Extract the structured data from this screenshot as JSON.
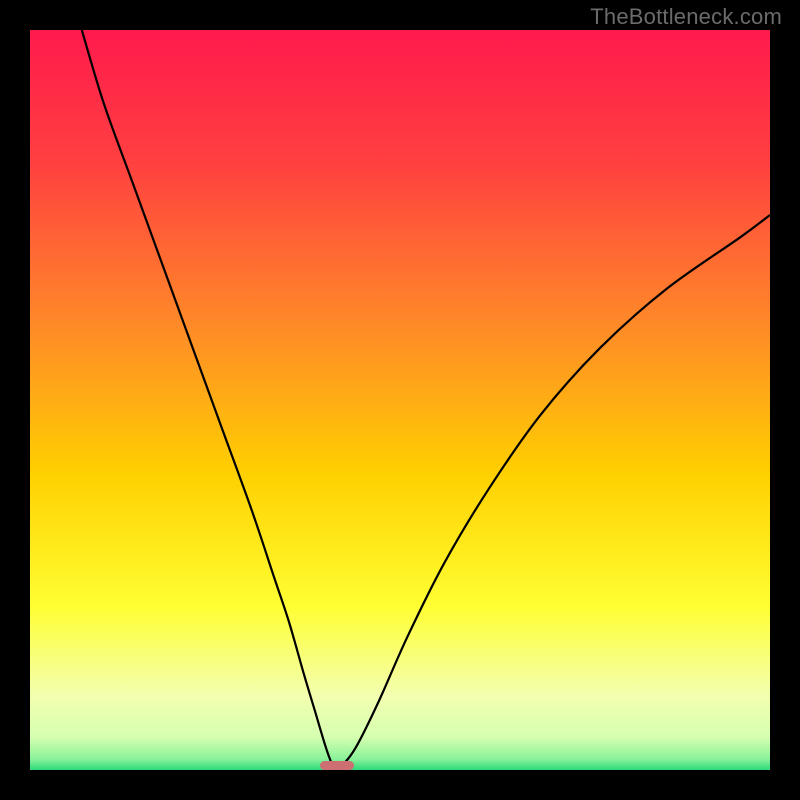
{
  "watermark": "TheBottleneck.com",
  "colors": {
    "frame_bg": "#000000",
    "gradient_stops": [
      {
        "offset": 0.0,
        "color": "#ff1a4d"
      },
      {
        "offset": 0.18,
        "color": "#ff4040"
      },
      {
        "offset": 0.4,
        "color": "#ff8a28"
      },
      {
        "offset": 0.6,
        "color": "#ffd000"
      },
      {
        "offset": 0.78,
        "color": "#ffff33"
      },
      {
        "offset": 0.9,
        "color": "#f3ffb0"
      },
      {
        "offset": 0.955,
        "color": "#d6ffb0"
      },
      {
        "offset": 0.985,
        "color": "#8bf29a"
      },
      {
        "offset": 1.0,
        "color": "#2cd97a"
      }
    ],
    "curve_stroke": "#000000",
    "marker_fill": "#cc6e72"
  },
  "chart_data": {
    "type": "line",
    "title": "",
    "xlabel": "",
    "ylabel": "",
    "xlim": [
      0,
      100
    ],
    "ylim": [
      0,
      100
    ],
    "grid": false,
    "legend": null,
    "series": [
      {
        "name": "bottleneck-curve",
        "x": [
          7,
          10,
          14,
          18,
          22,
          26,
          30,
          33,
          35,
          37,
          38.5,
          40,
          41,
          42,
          44,
          47,
          51,
          56,
          62,
          69,
          77,
          86,
          96,
          100
        ],
        "y": [
          100,
          90,
          79,
          68,
          57,
          46,
          35,
          26,
          20,
          13,
          8,
          3,
          0.5,
          0.5,
          3,
          9,
          18,
          28,
          38,
          48,
          57,
          65,
          72,
          75
        ]
      }
    ],
    "marker": {
      "x_center": 41.5,
      "y": 0,
      "width_pct": 4.5,
      "height_pct": 1.2
    }
  }
}
